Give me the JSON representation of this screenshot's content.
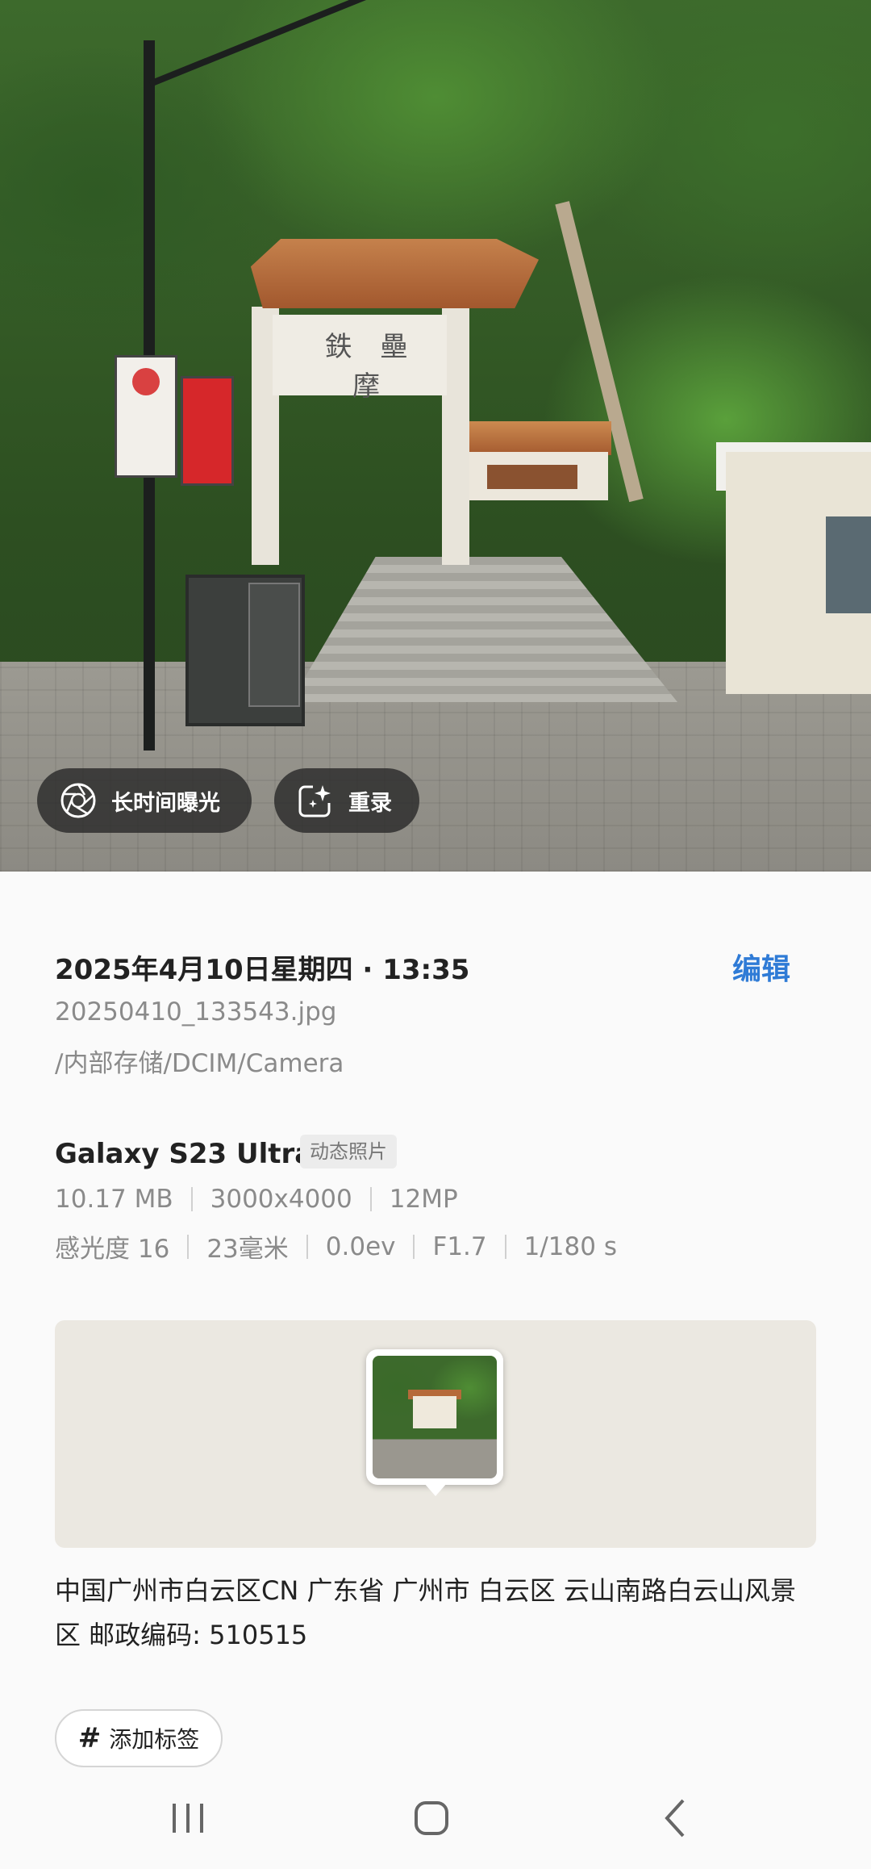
{
  "photo": {
    "gate_inscription": "鉄 壘 摩",
    "buttons": {
      "long_exposure": "长时间曝光",
      "remaster": "重录"
    }
  },
  "details": {
    "datetime": "2025年4月10日星期四 · 13:35",
    "edit_label": "编辑",
    "filename": "20250410_133543.jpg",
    "path": "/内部存储/DCIM/Camera",
    "device": "Galaxy S23 Ultra",
    "badge": "动态照片",
    "file_specs": [
      "10.17 MB",
      "3000x4000",
      "12MP"
    ],
    "camera_specs": [
      "感光度 16",
      "23毫米",
      "0.0ev",
      "F1.7",
      "1/180 s"
    ],
    "address": "中国广州市白云区CN 广东省 广州市 白云区 云山南路白云山风景区 邮政编码: 510515",
    "tag_button": "添加标签"
  },
  "colors": {
    "accent": "#2f7bd6",
    "secondary_text": "#8a8a8a",
    "map_bg": "#ebe8e1"
  },
  "icons": {
    "long_exposure": "aperture-icon",
    "remaster": "sparkle-frame-icon",
    "tag": "hash-icon",
    "nav": [
      "recent-apps-icon",
      "home-icon",
      "back-icon"
    ]
  }
}
